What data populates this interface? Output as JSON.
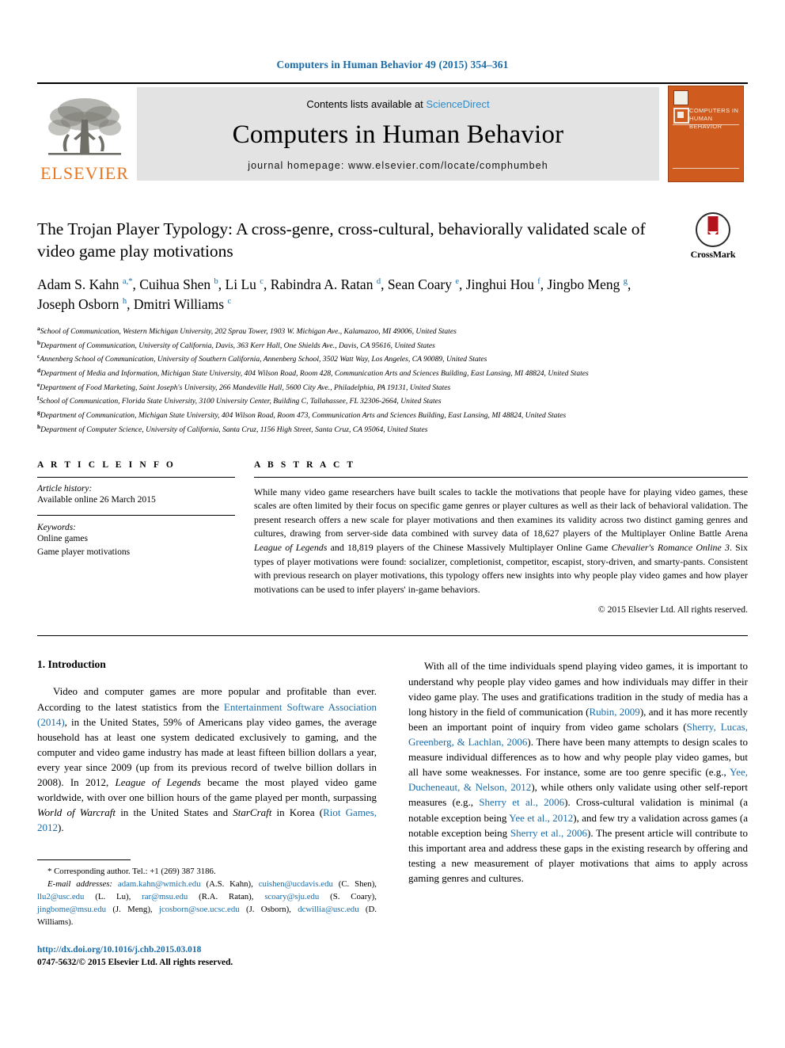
{
  "running_head": "Computers in Human Behavior 49 (2015) 354–361",
  "masthead": {
    "contents_prefix": "Contents lists available at ",
    "sciencedirect": "ScienceDirect",
    "journal_title": "Computers in Human Behavior",
    "homepage": "journal homepage: www.elsevier.com/locate/comphumbeh",
    "publisher_name": "ELSEVIER",
    "cover_title": "COMPUTERS IN HUMAN BEHAVIOR"
  },
  "article": {
    "title": "The Trojan Player Typology: A cross-genre, cross-cultural, behaviorally validated scale of video game play motivations",
    "crossmark_label": "CrossMark",
    "authors_line1": "Adam S. Kahn <sup>a,*</sup>, Cuihua Shen <sup>b</sup>, Li Lu <sup>c</sup>, Rabindra A. Ratan <sup>d</sup>, Sean Coary <sup>e</sup>, Jinghui Hou <sup>f</sup>, Jingbo Meng <sup>g</sup>,",
    "authors_line2": "Joseph Osborn <sup>h</sup>, Dmitri Williams <sup>c</sup>",
    "affiliations": [
      {
        "mark": "a",
        "text": "School of Communication, Western Michigan University, 202 Sprau Tower, 1903 W. Michigan Ave., Kalamazoo, MI 49006, United States"
      },
      {
        "mark": "b",
        "text": "Department of Communication, University of California, Davis, 363 Kerr Hall, One Shields Ave., Davis, CA 95616, United States"
      },
      {
        "mark": "c",
        "text": "Annenberg School of Communication, University of Southern California, Annenberg School, 3502 Watt Way, Los Angeles, CA 90089, United States"
      },
      {
        "mark": "d",
        "text": "Department of Media and Information, Michigan State University, 404 Wilson Road, Room 428, Communication Arts and Sciences Building, East Lansing, MI 48824, United States"
      },
      {
        "mark": "e",
        "text": "Department of Food Marketing, Saint Joseph's University, 266 Mandeville Hall, 5600 City Ave., Philadelphia, PA 19131, United States"
      },
      {
        "mark": "f",
        "text": "School of Communication, Florida State University, 3100 University Center, Building C, Tallahassee, FL 32306-2664, United States"
      },
      {
        "mark": "g",
        "text": "Department of Communication, Michigan State University, 404 Wilson Road, Room 473, Communication Arts and Sciences Building, East Lansing, MI 48824, United States"
      },
      {
        "mark": "h",
        "text": "Department of Computer Science, University of California, Santa Cruz, 1156 High Street, Santa Cruz, CA 95064, United States"
      }
    ]
  },
  "article_info": {
    "heading": "A R T I C L E  I N F O",
    "history_label": "Article history:",
    "history_value": "Available online 26 March 2015",
    "keywords_label": "Keywords:",
    "keywords": [
      "Online games",
      "Game player motivations"
    ]
  },
  "abstract": {
    "heading": "A B S T R A C T",
    "text_html": "While many video game researchers have built scales to tackle the motivations that people have for playing video games, these scales are often limited by their focus on specific game genres or player cultures as well as their lack of behavioral validation. The present research offers a new scale for player motivations and then examines its validity across two distinct gaming genres and cultures, drawing from server-side data combined with survey data of 18,627 players of the Multiplayer Online Battle Arena <em>League of Legends</em> and 18,819 players of the Chinese Massively Multiplayer Online Game <em>Chevalier's Romance Online 3</em>. Six types of player motivations were found: socializer, completionist, competitor, escapist, story-driven, and smarty-pants. Consistent with previous research on player motivations, this typology offers new insights into why people play video games and how player motivations can be used to infer players' in-game behaviors.",
    "copyright": "© 2015 Elsevier Ltd. All rights reserved."
  },
  "introduction": {
    "heading": "1. Introduction",
    "left_paragraph_html": "Video and computer games are more popular and profitable than ever. According to the latest statistics from the <span class=\"cite\">Entertainment Software Association (2014)</span>, in the United States, 59% of Americans play video games, the average household has at least one system dedicated exclusively to gaming, and the computer and video game industry has made at least fifteen billion dollars a year, every year since 2009 (up from its previous record of twelve billion dollars in 2008). In 2012, <em>League of Legends</em> became the most played video game worldwide, with over one billion hours of the game played per month, surpassing <em>World of Warcraft</em> in the United States and <em>StarCraft</em> in Korea (<span class=\"cite\">Riot Games, 2012</span>).",
    "right_paragraph_html": "With all of the time individuals spend playing video games, it is important to understand why people play video games and how individuals may differ in their video game play. The uses and gratifications tradition in the study of media has a long history in the field of communication (<span class=\"cite\">Rubin, 2009</span>), and it has more recently been an important point of inquiry from video game scholars (<span class=\"cite\">Sherry, Lucas, Greenberg, &amp; Lachlan, 2006</span>). There have been many attempts to design scales to measure individual differences as to how and why people play video games, but all have some weaknesses. For instance, some are too genre specific (e.g., <span class=\"cite\">Yee, Ducheneaut, &amp; Nelson, 2012</span>), while others only validate using other self-report measures (e.g., <span class=\"cite\">Sherry et al., 2006</span>). Cross-cultural validation is minimal (a notable exception being <span class=\"cite\">Yee et al., 2012</span>), and few try a validation across games (a notable exception being <span class=\"cite\">Sherry et al., 2006</span>). The present article will contribute to this important area and address these gaps in the existing research by offering and testing a new measurement of player motivations that aims to apply across gaming genres and cultures."
  },
  "footnotes": {
    "corresponding_html": "* Corresponding author. Tel.: +1 (269) 387 3186.",
    "emails_html": "<em>E-mail addresses:</em> <span class=\"mail\">adam.kahn@wmich.edu</span> (A.S. Kahn), <span class=\"mail\">cuishen@ucdavis.edu</span> (C. Shen), <span class=\"mail\">llu2@usc.edu</span> (L. Lu), <span class=\"mail\">rar@msu.edu</span> (R.A. Ratan), <span class=\"mail\">scoary@sju.edu</span> (S. Coary), <span class=\"mail\">jingbome@msu.edu</span> (J. Meng), <span class=\"mail\">jcosborn@soe.ucsc.edu</span> (J. Osborn), <span class=\"mail\">dcwillia@usc.edu</span> (D. Williams).",
    "doi": "http://dx.doi.org/10.1016/j.chb.2015.03.018",
    "issn": "0747-5632/© 2015 Elsevier Ltd. All rights reserved."
  },
  "colors": {
    "link_blue": "#1b6ca8",
    "sciencedirect_blue": "#2e8bc9",
    "elsevier_orange": "#E87722",
    "cover_orange": "#cf5c1e",
    "crossmark_red": "#b3141c"
  }
}
